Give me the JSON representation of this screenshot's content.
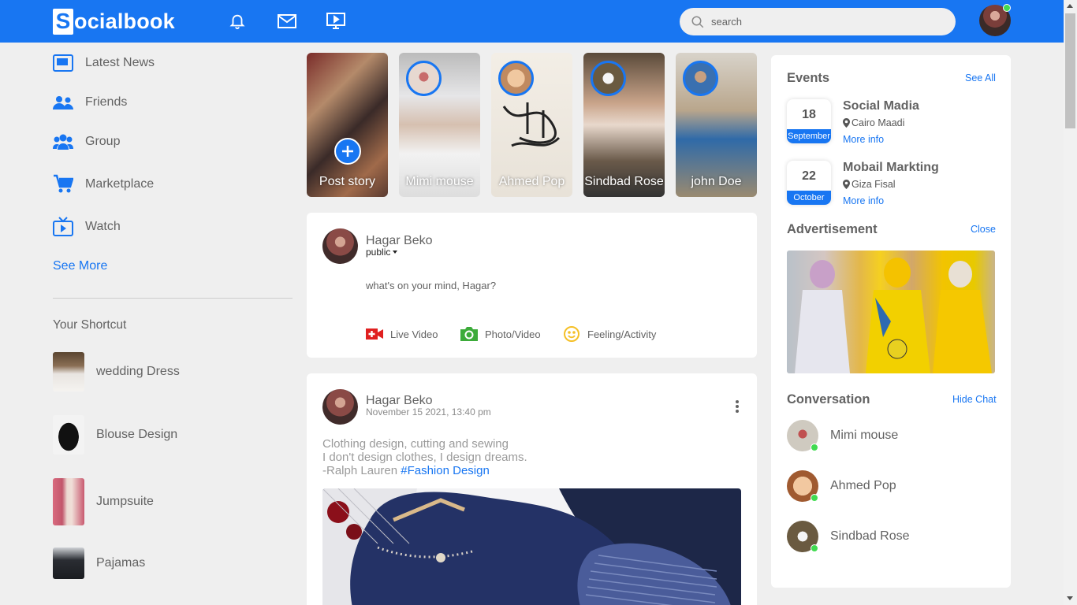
{
  "colors": {
    "brand": "#1876f2",
    "online": "#41db51",
    "background": "#efefef"
  },
  "navbar": {
    "logo_letter": "S",
    "logo_rest": "ocialbook",
    "icons": [
      "bell-icon",
      "mail-icon",
      "video-icon"
    ],
    "search_placeholder": "search"
  },
  "left_sidebar": {
    "links": [
      {
        "label": "Latest News",
        "icon": "news-icon"
      },
      {
        "label": "Friends",
        "icon": "friends-icon"
      },
      {
        "label": "Group",
        "icon": "group-icon"
      },
      {
        "label": "Marketplace",
        "icon": "cart-icon"
      },
      {
        "label": "Watch",
        "icon": "tv-icon"
      }
    ],
    "see_more": "See More",
    "shortcut_title": "Your Shortcut",
    "shortcuts": [
      {
        "label": "wedding Dress"
      },
      {
        "label": "Blouse Design"
      },
      {
        "label": "Jumpsuite"
      },
      {
        "label": "Pajamas"
      }
    ]
  },
  "stories": [
    {
      "label": "Post story"
    },
    {
      "label": "Mimi mouse"
    },
    {
      "label": "Ahmed Pop"
    },
    {
      "label": "Sindbad Rose"
    },
    {
      "label": "john Doe"
    }
  ],
  "composer": {
    "user_name": "Hagar Beko",
    "privacy": "public",
    "placeholder": "what's on your mind, Hagar?",
    "actions": [
      {
        "label": "Live Video",
        "icon": "live-video-icon"
      },
      {
        "label": "Photo/Video",
        "icon": "photo-icon"
      },
      {
        "label": "Feeling/Activity",
        "icon": "smile-icon"
      }
    ]
  },
  "post": {
    "user_name": "Hagar Beko",
    "timestamp": "November 15 2021, 13:40 pm",
    "lines": [
      "Clothing design, cutting and sewing",
      "I don't design clothes, I design dreams.",
      "-Ralph Lauren "
    ],
    "hashtag": "#Fashion Design"
  },
  "right_sidebar": {
    "events_title": "Events",
    "see_all": "See All",
    "events": [
      {
        "day": "18",
        "month": "September",
        "title": "Social Madia",
        "place": "Cairo Maadi",
        "more": "More info"
      },
      {
        "day": "22",
        "month": "October",
        "title": "Mobail Markting",
        "place": "Giza Fisal",
        "more": "More info"
      }
    ],
    "ad_title": "Advertisement",
    "ad_close": "Close",
    "conversation_title": "Conversation",
    "hide_chat": "Hide Chat",
    "contacts": [
      {
        "name": "Mimi mouse",
        "online": true
      },
      {
        "name": "Ahmed Pop",
        "online": true
      },
      {
        "name": "Sindbad Rose",
        "online": true
      }
    ]
  }
}
